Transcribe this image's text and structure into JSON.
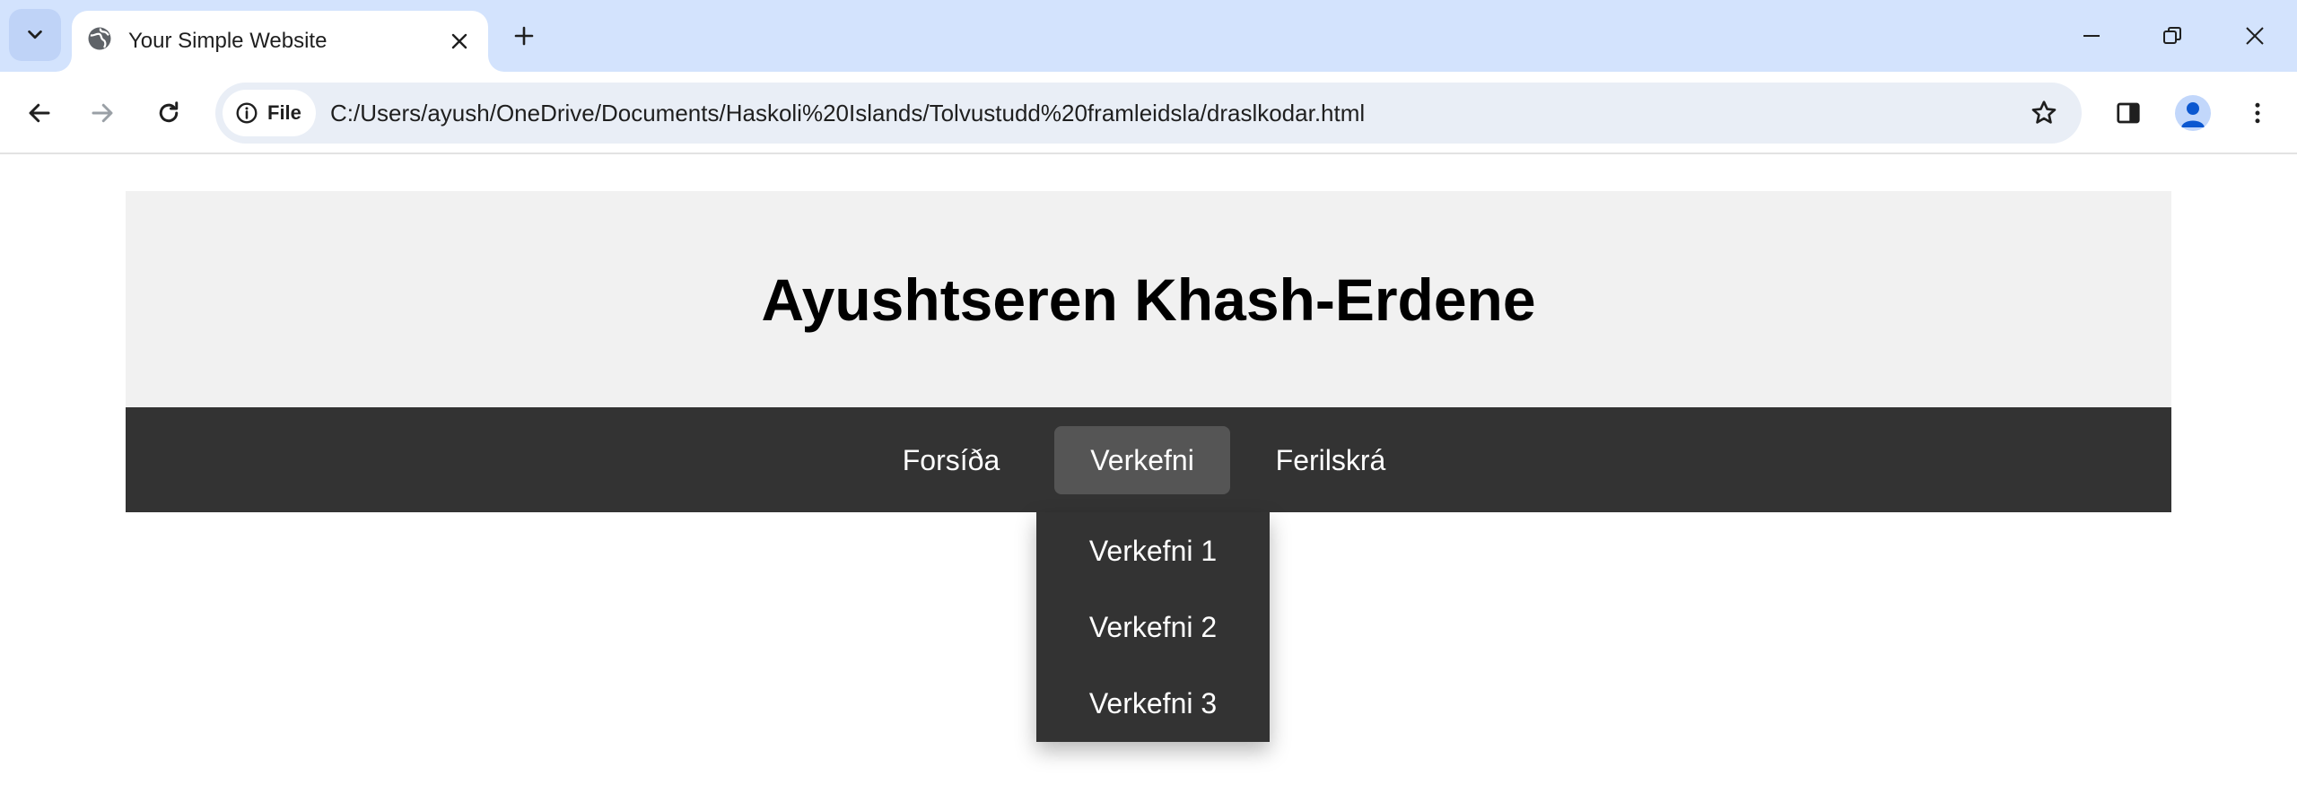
{
  "browser": {
    "tab": {
      "title": "Your Simple Website"
    },
    "omnibox": {
      "site_chip_label": "File",
      "url": "C:/Users/ayush/OneDrive/Documents/Haskoli%20Islands/Tolvustudd%20framleidsla/draslkodar.html"
    },
    "accent_color": "#d3e3fd"
  },
  "page": {
    "header": {
      "title": "Ayushtseren Khash-Erdene"
    },
    "nav": {
      "items": [
        {
          "label": "Forsíða"
        },
        {
          "label": "Verkefni"
        },
        {
          "label": "Ferilskrá"
        }
      ],
      "active_index": 1,
      "dropdown": {
        "items": [
          {
            "label": "Verkefni 1"
          },
          {
            "label": "Verkefni 2"
          },
          {
            "label": "Verkefni 3"
          }
        ]
      }
    },
    "colors": {
      "header_bg": "#f1f1f1",
      "nav_bg": "#333333",
      "active_bg": "#555555",
      "nav_text": "#ffffff"
    }
  }
}
